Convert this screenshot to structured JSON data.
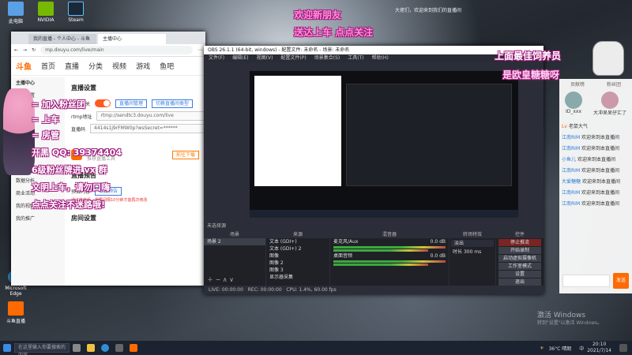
{
  "desktop": {
    "icons": [
      {
        "label": "此电脑",
        "color": "#5aa0e6"
      },
      {
        "label": "NVIDIA",
        "color": "#76b900"
      },
      {
        "label": "Steam",
        "color": "#1b2838"
      },
      {
        "label": "Microsoft Edge",
        "color": "#2f8fd6"
      },
      {
        "label": "斗鱼直播",
        "color": "#ff6a00"
      }
    ],
    "activate_title": "激活 Windows",
    "activate_sub": "转到\"设置\"以激活 Windows。",
    "overlay_top_left": "欢迎新朋友",
    "overlay_top_center": "送达上车 点点关注",
    "overlay_top_hint": "大佬们，欢迎来到我们的直播间",
    "overlay_right_top": "上面最佳饲养员",
    "overlay_right_bottom": "是欧皇糖糖呀"
  },
  "browser": {
    "tabs": [
      "我的直播 - 个人中心 - 斗鱼",
      "主播中心"
    ],
    "url": "mp.douyu.com/live/main",
    "site": {
      "logo": "斗鱼",
      "nav": [
        "首页",
        "直播",
        "分类",
        "视频",
        "游戏",
        "鱼吧"
      ]
    },
    "left_menu": [
      "主播中心",
      "直播设置",
      "我的视频",
      "我的公会",
      "数据分析",
      "商业活动",
      "我的视频",
      "我的推广"
    ],
    "main": {
      "title": "直播设置",
      "switch_label": "直播开关",
      "btn1": "直播间管理",
      "btn2": "切换直播间类型",
      "rtmp_label": "rtmp地址",
      "rtmp_value": "rtmp://sendtc3.douyu.com/live",
      "key_label": "直播码",
      "key_value": "4414s1j9rFMW0p?wsSecret=******",
      "tool_name": "斗鱼直播伴侣",
      "tool_sub": "推荐直播工具",
      "tool_btn": "前往下载",
      "preview_title": "直播预告",
      "preview_label": "预告内容",
      "preview_btn": "设置预告",
      "preview_note": "通过审核后，需要间隔10分钟才能再次修改",
      "room_title": "房间设置"
    }
  },
  "overlay_panel": [
    "= 加入粉丝团",
    "= 上车",
    "= 房管",
    "开黑 QQ: 39374404",
    "6级粉丝牌进 vx 群",
    "文明上车，请勿口嗨",
    "点点关注不迷路哦!"
  ],
  "obs": {
    "title": "OBS 26.1.1 (64-bit, windows) - 配置文件: 未命名 - 场景: 未命名",
    "menu": [
      "文件(F)",
      "编辑(E)",
      "视图(V)",
      "配置文件(P)",
      "场景集合(S)",
      "工具(T)",
      "帮助(H)"
    ],
    "scene_bar": "未选择源",
    "scenes": {
      "header": "场景",
      "items": [
        "场景 2"
      ]
    },
    "sources": {
      "header": "来源",
      "items": [
        "文本 (GDI+)",
        "文本 (GDI+) 2",
        "图像",
        "图像 2",
        "图像 3",
        "显示器采集"
      ]
    },
    "mixer": {
      "header": "混音器",
      "items": [
        {
          "name": "麦克风/Aux",
          "db": "0.0 dB"
        },
        {
          "name": "桌面音频",
          "db": "0.0 dB"
        }
      ]
    },
    "transitions": {
      "header": "转场特效",
      "type": "淡出",
      "duration_label": "时长",
      "duration": "300 ms"
    },
    "controls": {
      "header": "控件",
      "buttons": [
        "停止推流",
        "开始录制",
        "启动虚拟摄像机",
        "工作室模式",
        "设置",
        "退出"
      ]
    },
    "status": {
      "live": "LIVE: 00:00:00",
      "rec": "REC: 00:00:00",
      "cpu": "CPU: 1.4%, 60.00 fps"
    }
  },
  "chat": {
    "tabs": [
      "贡献榜",
      "粉丝团"
    ],
    "top_users": [
      {
        "name": "ID_xxx"
      },
      {
        "name": "大冲呆呆仔汇了"
      }
    ],
    "messages": [
      {
        "badge": "Lv",
        "name": "",
        "text": "老鼠大气"
      },
      {
        "badge": "",
        "name": "江南RIM",
        "text": "欢迎来到本直播间"
      },
      {
        "badge": "",
        "name": "江南RIM",
        "text": "欢迎来到本直播间"
      },
      {
        "badge": "",
        "name": "小鱼儿",
        "text": "欢迎来到本直播间"
      },
      {
        "badge": "",
        "name": "江南RIM",
        "text": "欢迎来到本直播间"
      },
      {
        "badge": "",
        "name": "大爱糖糖",
        "text": "欢迎来到本直播间"
      },
      {
        "badge": "",
        "name": "江南RIM",
        "text": "欢迎来到本直播间"
      },
      {
        "badge": "",
        "name": "江南RIM",
        "text": "欢迎来到本直播间"
      }
    ],
    "send": "发送"
  },
  "taskbar": {
    "search_placeholder": "在这里输入你要搜索的内容",
    "weather": "36°C 晴朗",
    "ime": "中",
    "time": "20:10",
    "date": "2021/7/14"
  }
}
